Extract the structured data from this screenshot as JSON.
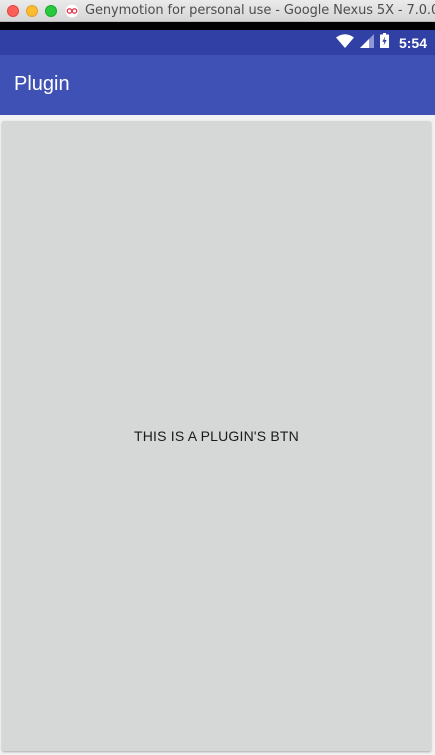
{
  "window": {
    "title": "Genymotion for personal use - Google Nexus 5X - 7.0.0 -"
  },
  "status_bar": {
    "time": "5:54",
    "icons": [
      "wifi-icon",
      "cell-signal-icon",
      "battery-charging-icon"
    ]
  },
  "app_bar": {
    "title": "Plugin"
  },
  "main": {
    "plugin_button_label": "THIS IS A PLUGIN'S BTN"
  },
  "colors": {
    "status_bar": "#3140a4",
    "app_bar": "#3f51b5",
    "button_bg": "#d6d7d7"
  }
}
